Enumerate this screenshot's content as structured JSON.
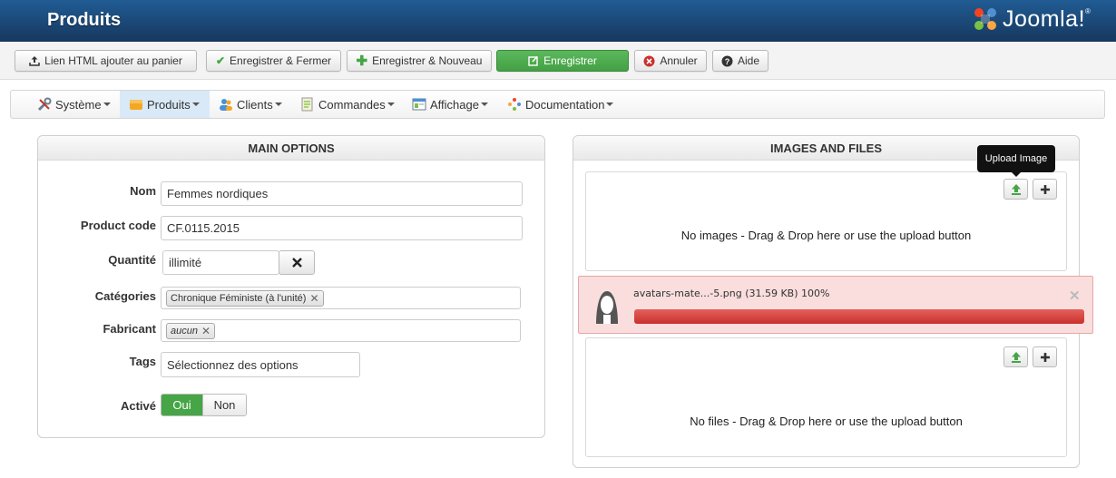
{
  "header": {
    "title": "Produits",
    "logo_text": "Joomla!",
    "logo_reg": "®"
  },
  "toolbar": {
    "html_link_label": "Lien HTML ajouter au panier",
    "save_close_label": "Enregistrer & Fermer",
    "save_new_label": "Enregistrer & Nouveau",
    "save_label": "Enregistrer",
    "cancel_label": "Annuler",
    "help_label": "Aide"
  },
  "menu": {
    "items": [
      {
        "label": "Système",
        "icon": "tools-icon"
      },
      {
        "label": "Produits",
        "icon": "products-icon"
      },
      {
        "label": "Clients",
        "icon": "customers-icon"
      },
      {
        "label": "Commandes",
        "icon": "orders-icon"
      },
      {
        "label": "Affichage",
        "icon": "display-icon"
      },
      {
        "label": "Documentation",
        "icon": "documentation-icon"
      }
    ]
  },
  "main_options": {
    "title": "MAIN OPTIONS",
    "name_label": "Nom",
    "name_value": "Femmes nordiques",
    "code_label": "Product code",
    "code_value": "CF.0115.2015",
    "qty_label": "Quantité",
    "qty_value": "illimité",
    "categories_label": "Catégories",
    "category_chip": "Chronique Féministe (à l'unité)",
    "manufacturer_label": "Fabricant",
    "manufacturer_chip": "aucun",
    "tags_label": "Tags",
    "tags_placeholder": "Sélectionnez des options",
    "active_label": "Activé",
    "yes_label": "Oui",
    "no_label": "Non"
  },
  "images_files": {
    "title": "IMAGES AND FILES",
    "tooltip": "Upload Image",
    "no_images": "No images - Drag & Drop here or use the upload button",
    "no_files": "No files - Drag & Drop here or use the upload button",
    "upload_file": "avatars-mate...-5.png (31.59 KB)  100%",
    "upload_progress": 1.0
  },
  "colors": {
    "header": "#1a4a7d",
    "accent_green": "#46a546",
    "progress_red": "#d9534f"
  }
}
